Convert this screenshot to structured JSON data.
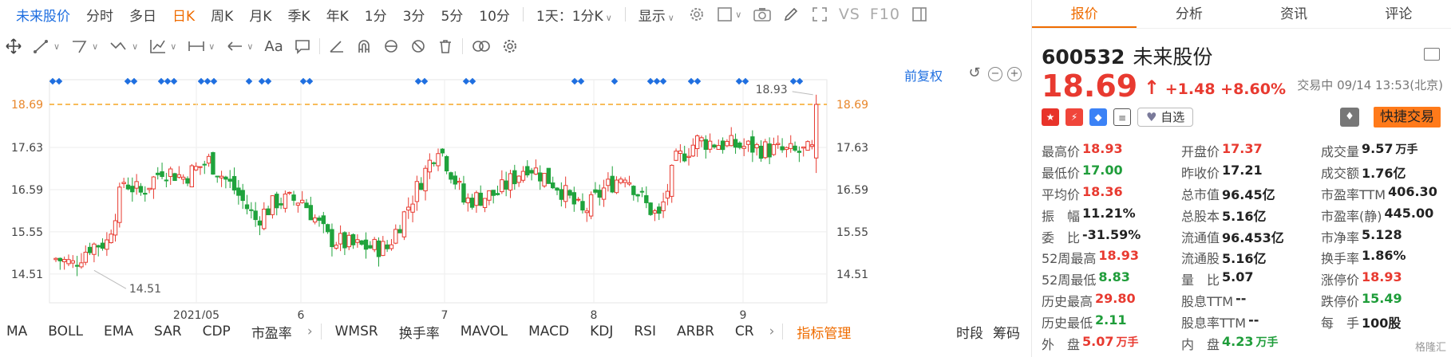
{
  "toolbar": {
    "tabs": [
      "未来股价",
      "分时",
      "多日",
      "日K",
      "周K",
      "月K",
      "季K",
      "年K",
      "1分",
      "3分",
      "5分",
      "10分"
    ],
    "active_tab": "日K",
    "period_select": "1天：1分K",
    "display_label": "显示",
    "vs_label": "VS",
    "f10_label": "F10"
  },
  "drawing": {
    "text_tool": "Aa"
  },
  "chart": {
    "adjust_label": "前复权",
    "current_price_label": "18.69",
    "high_label": "18.93",
    "low_label": "14.51",
    "accent_line_color": "#f5a623",
    "marker_color": "#1f6fe0"
  },
  "chart_data": {
    "type": "candlestick",
    "ylim": [
      13.8,
      19.3
    ],
    "yticks": [
      "18.69",
      "17.63",
      "16.59",
      "15.55",
      "14.51"
    ],
    "xticks": [
      "2021/05",
      "6",
      "7",
      "8",
      "9"
    ],
    "max_marker": "18.93",
    "min_marker": "14.51",
    "last_price": 18.69,
    "up_color": "#e83a30",
    "down_color": "#1fa33c"
  },
  "indicators": {
    "items": [
      "MA",
      "BOLL",
      "EMA",
      "SAR",
      "CDP",
      "市盈率",
      "WMSR",
      "换手率",
      "MAVOL",
      "MACD",
      "KDJ",
      "RSI",
      "ARBR",
      "CR"
    ],
    "manage": "指标管理",
    "right": [
      "时段",
      "筹码"
    ]
  },
  "panel": {
    "tabs": [
      "报价",
      "分析",
      "资讯",
      "评论"
    ],
    "code": "600532",
    "name": "未来股份",
    "price": "18.69",
    "change": "+1.48",
    "change_pct": "+8.60%",
    "status": "交易中 09/14 13:53(北京)",
    "watch_label": "自选",
    "quick_trade": "快捷交易",
    "rows": [
      [
        {
          "l": "最高价",
          "v": "18.93",
          "c": "up"
        },
        {
          "l": "开盘价",
          "v": "17.37",
          "c": "up"
        },
        {
          "l": "成交量",
          "v": "9.57",
          "u": "万手",
          "c": ""
        }
      ],
      [
        {
          "l": "最低价",
          "v": "17.00",
          "c": "down"
        },
        {
          "l": "昨收价",
          "v": "17.21",
          "c": ""
        },
        {
          "l": "成交额",
          "v": "1.76亿",
          "c": ""
        }
      ],
      [
        {
          "l": "平均价",
          "v": "18.36",
          "c": "up"
        },
        {
          "l": "总市值",
          "v": "96.45亿",
          "c": ""
        },
        {
          "l": "市盈率TTM",
          "v": "406.30",
          "c": ""
        }
      ],
      [
        {
          "l": "振　幅",
          "v": "11.21%",
          "c": ""
        },
        {
          "l": "总股本",
          "v": "5.16亿",
          "c": ""
        },
        {
          "l": "市盈率(静)",
          "v": "445.00",
          "c": ""
        }
      ],
      [
        {
          "l": "委　比",
          "v": "-31.59%",
          "c": ""
        },
        {
          "l": "流通值",
          "v": "96.453亿",
          "c": ""
        },
        {
          "l": "市净率",
          "v": "5.128",
          "c": ""
        }
      ],
      [
        {
          "l": "52周最高",
          "v": "18.93",
          "c": "up"
        },
        {
          "l": "流通股",
          "v": "5.16亿",
          "c": ""
        },
        {
          "l": "换手率",
          "v": "1.86%",
          "c": ""
        }
      ],
      [
        {
          "l": "52周最低",
          "v": "8.83",
          "c": "down"
        },
        {
          "l": "量　比",
          "v": "5.07",
          "c": ""
        },
        {
          "l": "涨停价",
          "v": "18.93",
          "c": "up"
        }
      ],
      [
        {
          "l": "历史最高",
          "v": "29.80",
          "c": "up"
        },
        {
          "l": "股息TTM",
          "v": "--",
          "c": ""
        },
        {
          "l": "跌停价",
          "v": "15.49",
          "c": "down"
        }
      ],
      [
        {
          "l": "历史最低",
          "v": "2.11",
          "c": "down"
        },
        {
          "l": "股息率TTM",
          "v": "--",
          "c": ""
        },
        {
          "l": "每　手",
          "v": "100股",
          "c": ""
        }
      ],
      [
        {
          "l": "外　盘",
          "v": "5.07",
          "u": "万手",
          "c": "up"
        },
        {
          "l": "内　盘",
          "v": "4.23",
          "u": "万手",
          "c": "down"
        },
        {
          "l": "",
          "v": "",
          "c": ""
        }
      ]
    ],
    "watermark": "格隆汇"
  }
}
